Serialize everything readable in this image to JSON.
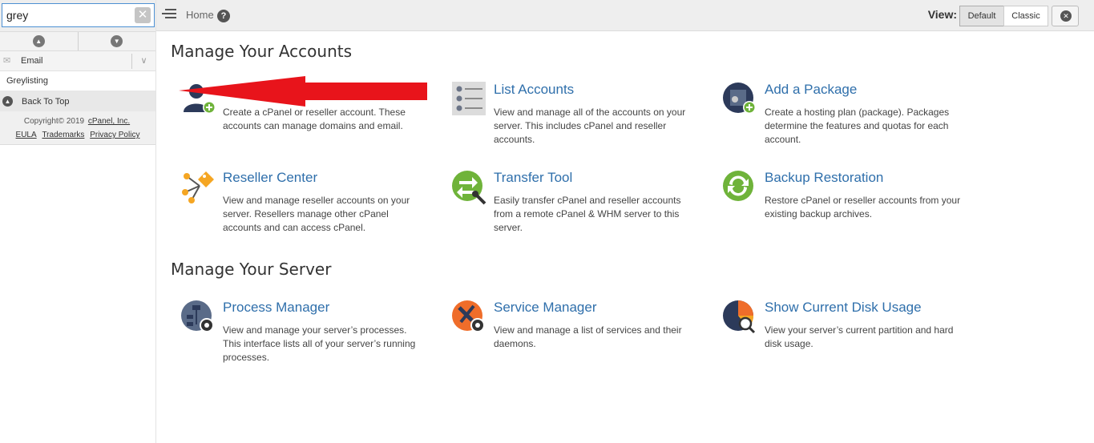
{
  "sidebar": {
    "search_value": "grey",
    "category_label": "Email",
    "result_label": "Greylisting",
    "back_to_top": "Back To Top",
    "copyright": "Copyright© 2019",
    "copyright_link": "cPanel, Inc.",
    "footer_links": [
      "EULA",
      "Trademarks",
      "Privacy Policy"
    ]
  },
  "topbar": {
    "breadcrumb": "Home",
    "help": "?",
    "view_label": "View:",
    "view_default": "Default",
    "view_classic": "Classic"
  },
  "sections": [
    {
      "title": "Manage Your Accounts",
      "items": [
        {
          "title": "",
          "icon": "create-account-icon",
          "desc": "Create a cPanel or reseller account. These accounts can manage domains and email."
        },
        {
          "title": "List Accounts",
          "icon": "list-accounts-icon",
          "desc": "View and manage all of the accounts on your server. This includes cPanel and reseller accounts."
        },
        {
          "title": "Add a Package",
          "icon": "add-package-icon",
          "desc": "Create a hosting plan (package). Packages determine the features and quotas for each account."
        },
        {
          "title": "Reseller Center",
          "icon": "reseller-center-icon",
          "desc": "View and manage reseller accounts on your server. Resellers manage other cPanel accounts and can access cPanel."
        },
        {
          "title": "Transfer Tool",
          "icon": "transfer-tool-icon",
          "desc": "Easily transfer cPanel and reseller accounts from a remote cPanel & WHM server to this server."
        },
        {
          "title": "Backup Restoration",
          "icon": "backup-restoration-icon",
          "desc": "Restore cPanel or reseller accounts from your existing backup archives."
        }
      ]
    },
    {
      "title": "Manage Your Server",
      "items": [
        {
          "title": "Process Manager",
          "icon": "process-manager-icon",
          "desc": "View and manage your server’s processes. This interface lists all of your server’s running processes."
        },
        {
          "title": "Service Manager",
          "icon": "service-manager-icon",
          "desc": "View and manage a list of services and their daemons."
        },
        {
          "title": "Show Current Disk Usage",
          "icon": "disk-usage-icon",
          "desc": "View your server’s current partition and hard disk usage."
        }
      ]
    }
  ],
  "colors": {
    "link": "#2f6fab",
    "annotation_arrow": "#e8141b",
    "icon_gear": "#333333",
    "icon_green": "#6fb33a",
    "icon_orange": "#ef6d2a",
    "icon_navy": "#2c3a5a"
  }
}
